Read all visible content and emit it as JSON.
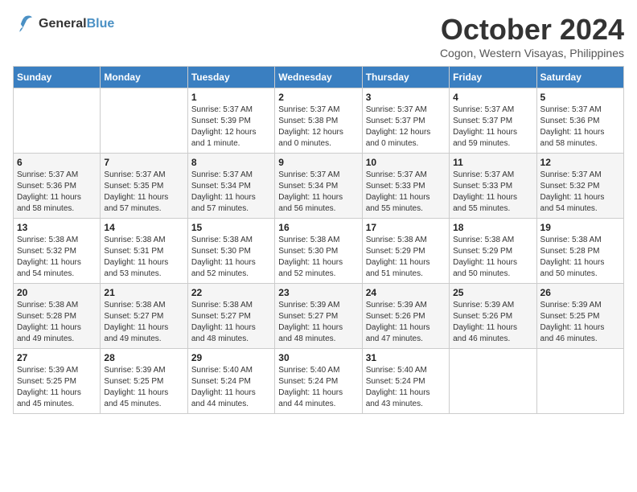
{
  "logo": {
    "line1": "General",
    "line2": "Blue"
  },
  "title": "October 2024",
  "location": "Cogon, Western Visayas, Philippines",
  "days_header": [
    "Sunday",
    "Monday",
    "Tuesday",
    "Wednesday",
    "Thursday",
    "Friday",
    "Saturday"
  ],
  "weeks": [
    [
      {
        "day": "",
        "info": ""
      },
      {
        "day": "",
        "info": ""
      },
      {
        "day": "1",
        "info": "Sunrise: 5:37 AM\nSunset: 5:39 PM\nDaylight: 12 hours\nand 1 minute."
      },
      {
        "day": "2",
        "info": "Sunrise: 5:37 AM\nSunset: 5:38 PM\nDaylight: 12 hours\nand 0 minutes."
      },
      {
        "day": "3",
        "info": "Sunrise: 5:37 AM\nSunset: 5:37 PM\nDaylight: 12 hours\nand 0 minutes."
      },
      {
        "day": "4",
        "info": "Sunrise: 5:37 AM\nSunset: 5:37 PM\nDaylight: 11 hours\nand 59 minutes."
      },
      {
        "day": "5",
        "info": "Sunrise: 5:37 AM\nSunset: 5:36 PM\nDaylight: 11 hours\nand 58 minutes."
      }
    ],
    [
      {
        "day": "6",
        "info": "Sunrise: 5:37 AM\nSunset: 5:36 PM\nDaylight: 11 hours\nand 58 minutes."
      },
      {
        "day": "7",
        "info": "Sunrise: 5:37 AM\nSunset: 5:35 PM\nDaylight: 11 hours\nand 57 minutes."
      },
      {
        "day": "8",
        "info": "Sunrise: 5:37 AM\nSunset: 5:34 PM\nDaylight: 11 hours\nand 57 minutes."
      },
      {
        "day": "9",
        "info": "Sunrise: 5:37 AM\nSunset: 5:34 PM\nDaylight: 11 hours\nand 56 minutes."
      },
      {
        "day": "10",
        "info": "Sunrise: 5:37 AM\nSunset: 5:33 PM\nDaylight: 11 hours\nand 55 minutes."
      },
      {
        "day": "11",
        "info": "Sunrise: 5:37 AM\nSunset: 5:33 PM\nDaylight: 11 hours\nand 55 minutes."
      },
      {
        "day": "12",
        "info": "Sunrise: 5:37 AM\nSunset: 5:32 PM\nDaylight: 11 hours\nand 54 minutes."
      }
    ],
    [
      {
        "day": "13",
        "info": "Sunrise: 5:38 AM\nSunset: 5:32 PM\nDaylight: 11 hours\nand 54 minutes."
      },
      {
        "day": "14",
        "info": "Sunrise: 5:38 AM\nSunset: 5:31 PM\nDaylight: 11 hours\nand 53 minutes."
      },
      {
        "day": "15",
        "info": "Sunrise: 5:38 AM\nSunset: 5:30 PM\nDaylight: 11 hours\nand 52 minutes."
      },
      {
        "day": "16",
        "info": "Sunrise: 5:38 AM\nSunset: 5:30 PM\nDaylight: 11 hours\nand 52 minutes."
      },
      {
        "day": "17",
        "info": "Sunrise: 5:38 AM\nSunset: 5:29 PM\nDaylight: 11 hours\nand 51 minutes."
      },
      {
        "day": "18",
        "info": "Sunrise: 5:38 AM\nSunset: 5:29 PM\nDaylight: 11 hours\nand 50 minutes."
      },
      {
        "day": "19",
        "info": "Sunrise: 5:38 AM\nSunset: 5:28 PM\nDaylight: 11 hours\nand 50 minutes."
      }
    ],
    [
      {
        "day": "20",
        "info": "Sunrise: 5:38 AM\nSunset: 5:28 PM\nDaylight: 11 hours\nand 49 minutes."
      },
      {
        "day": "21",
        "info": "Sunrise: 5:38 AM\nSunset: 5:27 PM\nDaylight: 11 hours\nand 49 minutes."
      },
      {
        "day": "22",
        "info": "Sunrise: 5:38 AM\nSunset: 5:27 PM\nDaylight: 11 hours\nand 48 minutes."
      },
      {
        "day": "23",
        "info": "Sunrise: 5:39 AM\nSunset: 5:27 PM\nDaylight: 11 hours\nand 48 minutes."
      },
      {
        "day": "24",
        "info": "Sunrise: 5:39 AM\nSunset: 5:26 PM\nDaylight: 11 hours\nand 47 minutes."
      },
      {
        "day": "25",
        "info": "Sunrise: 5:39 AM\nSunset: 5:26 PM\nDaylight: 11 hours\nand 46 minutes."
      },
      {
        "day": "26",
        "info": "Sunrise: 5:39 AM\nSunset: 5:25 PM\nDaylight: 11 hours\nand 46 minutes."
      }
    ],
    [
      {
        "day": "27",
        "info": "Sunrise: 5:39 AM\nSunset: 5:25 PM\nDaylight: 11 hours\nand 45 minutes."
      },
      {
        "day": "28",
        "info": "Sunrise: 5:39 AM\nSunset: 5:25 PM\nDaylight: 11 hours\nand 45 minutes."
      },
      {
        "day": "29",
        "info": "Sunrise: 5:40 AM\nSunset: 5:24 PM\nDaylight: 11 hours\nand 44 minutes."
      },
      {
        "day": "30",
        "info": "Sunrise: 5:40 AM\nSunset: 5:24 PM\nDaylight: 11 hours\nand 44 minutes."
      },
      {
        "day": "31",
        "info": "Sunrise: 5:40 AM\nSunset: 5:24 PM\nDaylight: 11 hours\nand 43 minutes."
      },
      {
        "day": "",
        "info": ""
      },
      {
        "day": "",
        "info": ""
      }
    ]
  ]
}
